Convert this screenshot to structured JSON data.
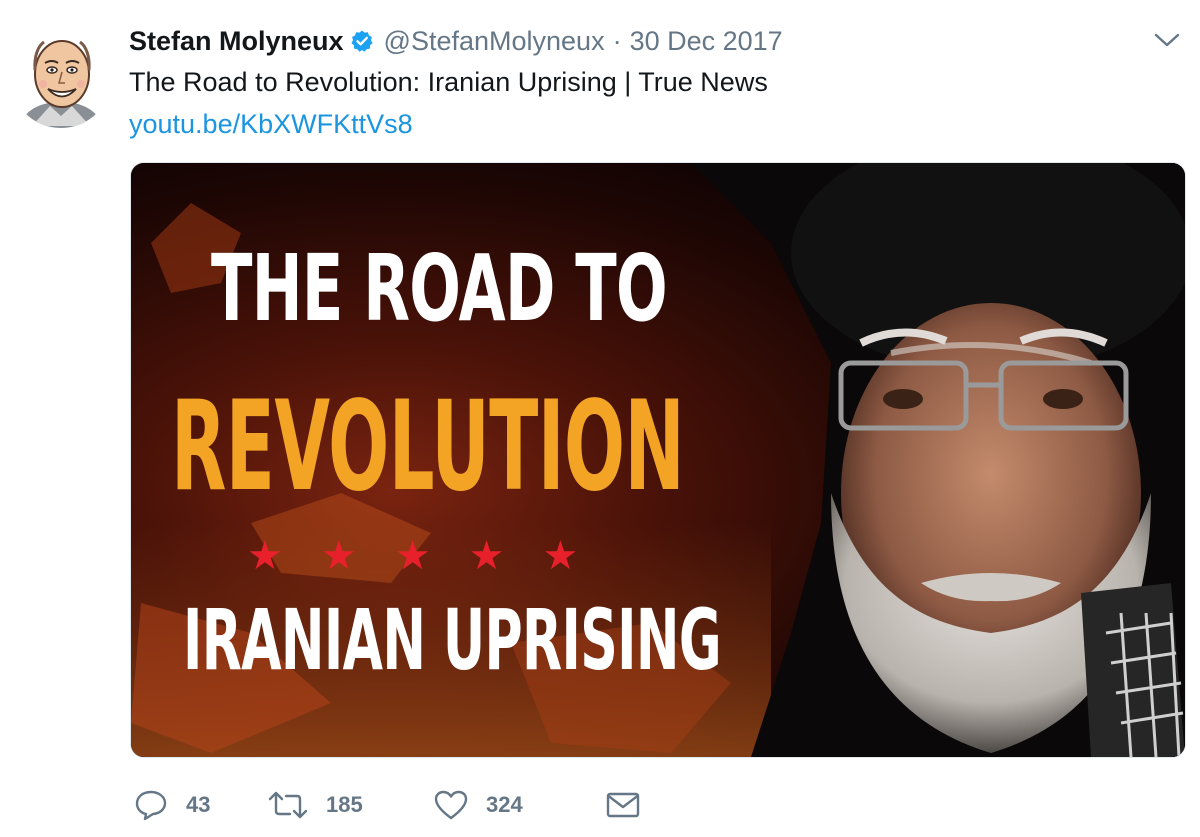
{
  "author": {
    "display_name": "Stefan Molyneux",
    "handle": "@StefanMolyneux",
    "separator": "·",
    "date": "30 Dec 2017",
    "verified": true,
    "avatar_icon": "cartoon-avatar-icon"
  },
  "tweet": {
    "text": "The Road to Revolution: Iranian Uprising | True News",
    "link_text": "youtu.be/KbXWFKttVs8"
  },
  "media": {
    "line1": "THE ROAD TO",
    "line2": "REVOLUTION",
    "stars": "★★★★★",
    "line3": "IRANIAN UPRISING"
  },
  "actions": {
    "reply_count": "43",
    "retweet_count": "185",
    "like_count": "324"
  },
  "colors": {
    "link": "#1b95e0",
    "verified": "#1da1f2",
    "muted": "#657786",
    "accent_orange": "#f3a424",
    "star_red": "#e8202c"
  },
  "icons": {
    "caret": "chevron-down-icon",
    "reply": "reply-icon",
    "retweet": "retweet-icon",
    "like": "heart-icon",
    "dm": "envelope-icon"
  }
}
